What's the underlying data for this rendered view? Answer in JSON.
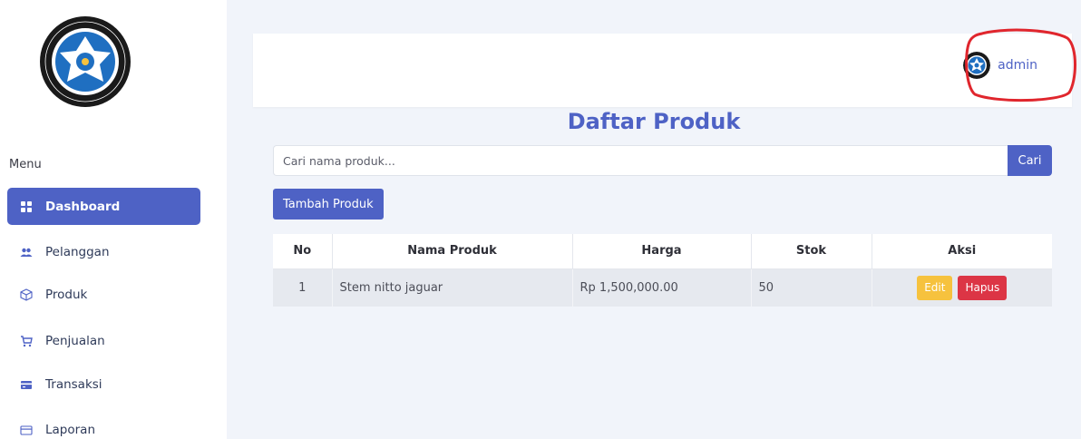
{
  "sidebar": {
    "logo_text": "SEKOLAH MENENGAH KEJURUAN INFORMATIKA UTAMA • DEPOK •",
    "menu_heading": "Menu",
    "items": [
      {
        "label": "Dashboard",
        "icon": "grid-icon",
        "active": true
      },
      {
        "label": "Pelanggan",
        "icon": "users-icon",
        "active": false
      },
      {
        "label": "Produk",
        "icon": "box-icon",
        "active": false
      },
      {
        "label": "Penjualan",
        "icon": "cart-icon",
        "active": false
      },
      {
        "label": "Transaksi",
        "icon": "wallet-icon",
        "active": false
      },
      {
        "label": "Laporan",
        "icon": "card-icon",
        "active": false
      }
    ]
  },
  "topbar": {
    "username": "admin",
    "highlight_color": "#e0262d"
  },
  "main": {
    "title": "Daftar Produk",
    "search": {
      "placeholder": "Cari nama produk...",
      "button_label": "Cari"
    },
    "add_button_label": "Tambah Produk",
    "table": {
      "headers": [
        "No",
        "Nama Produk",
        "Harga",
        "Stok",
        "Aksi"
      ],
      "rows": [
        {
          "no": "1",
          "name": "Stem nitto jaguar",
          "price": "Rp 1,500,000.00",
          "stok": "50",
          "edit_label": "Edit",
          "delete_label": "Hapus"
        }
      ]
    }
  },
  "colors": {
    "primary": "#4e62c5",
    "warning": "#f6c23e",
    "danger": "#dc3545",
    "background": "#f1f4fa"
  }
}
